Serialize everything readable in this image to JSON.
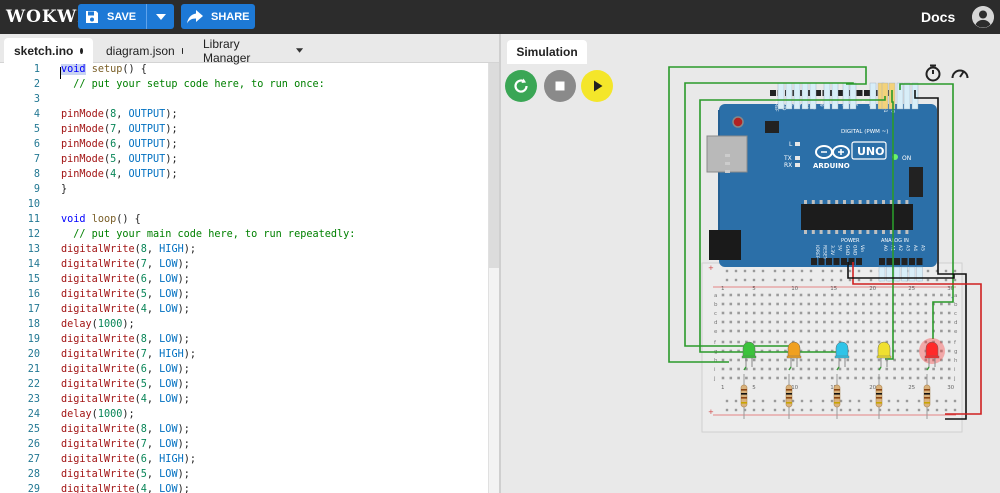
{
  "app": {
    "logo": "WOKWI",
    "save_label": "SAVE",
    "share_label": "SHARE",
    "docs_label": "Docs"
  },
  "tabs": [
    {
      "label": "sketch.ino",
      "modified": true,
      "active": true
    },
    {
      "label": "diagram.json",
      "modified": true,
      "active": false
    },
    {
      "label": "Library Manager",
      "modified": false,
      "active": false
    }
  ],
  "code_lines": [
    "void setup() {",
    "  // put your setup code here, to run once:",
    "",
    "pinMode(8, OUTPUT);",
    "pinMode(7, OUTPUT);",
    "pinMode(6, OUTPUT);",
    "pinMode(5, OUTPUT);",
    "pinMode(4, OUTPUT);",
    "}",
    "",
    "void loop() {",
    "  // put your main code here, to run repeatedly:",
    "digitalWrite(8, HIGH);",
    "digitalWrite(7, LOW);",
    "digitalWrite(6, LOW);",
    "digitalWrite(5, LOW);",
    "digitalWrite(4, LOW);",
    "delay(1000);",
    "digitalWrite(8, LOW);",
    "digitalWrite(7, HIGH);",
    "digitalWrite(6, LOW);",
    "digitalWrite(5, LOW);",
    "digitalWrite(4, LOW);",
    "delay(1000);",
    "digitalWrite(8, LOW);",
    "digitalWrite(7, LOW);",
    "digitalWrite(6, HIGH);",
    "digitalWrite(5, LOW);",
    "digitalWrite(4, LOW);"
  ],
  "simulation": {
    "tab_label": "Simulation",
    "restart_color": "#3aa655",
    "stop_color": "#8a8a8a",
    "play_color": "#f4e62a"
  },
  "board": {
    "name": "UNO",
    "brand": "ARDUINO",
    "on_label": "ON",
    "digital_label": "DIGITAL (PWM ~)",
    "power_label": "POWER",
    "analog_label": "ANALOG IN",
    "aref_label": "AREF",
    "gnd_label": "GND",
    "l_label": "L",
    "tx_label": "TX",
    "rx_label": "RX",
    "header_pins_top": [
      "AREF",
      "GND",
      "13",
      "12",
      "~11",
      "~10",
      "~9",
      "8",
      "7",
      "~6",
      "~5",
      "4",
      "~3",
      "2",
      "TX→1",
      "RX←0"
    ],
    "header_pins_power": [
      "IOREF",
      "RESET",
      "3.3V",
      "5V",
      "GND",
      "GND",
      "Vin"
    ],
    "header_pins_analog": [
      "A0",
      "A1",
      "A2",
      "A3",
      "A4",
      "A5"
    ]
  },
  "breadboard": {
    "column_numbers": [
      "1",
      "5",
      "10",
      "15",
      "20",
      "25",
      "30"
    ],
    "row_letters_top": [
      "j",
      "i",
      "h",
      "g",
      "f"
    ],
    "row_letters_bottom": [
      "e",
      "d",
      "c",
      "b",
      "a"
    ],
    "rail_plus": "+",
    "rail_minus": "-"
  },
  "leds": [
    {
      "color": "#3cc33c",
      "name": "green"
    },
    {
      "color": "#f0a020",
      "name": "orange"
    },
    {
      "color": "#2fc4e8",
      "name": "cyan"
    },
    {
      "color": "#f0e030",
      "name": "yellow"
    },
    {
      "color": "#ff2a2a",
      "name": "red",
      "lit": true
    }
  ]
}
